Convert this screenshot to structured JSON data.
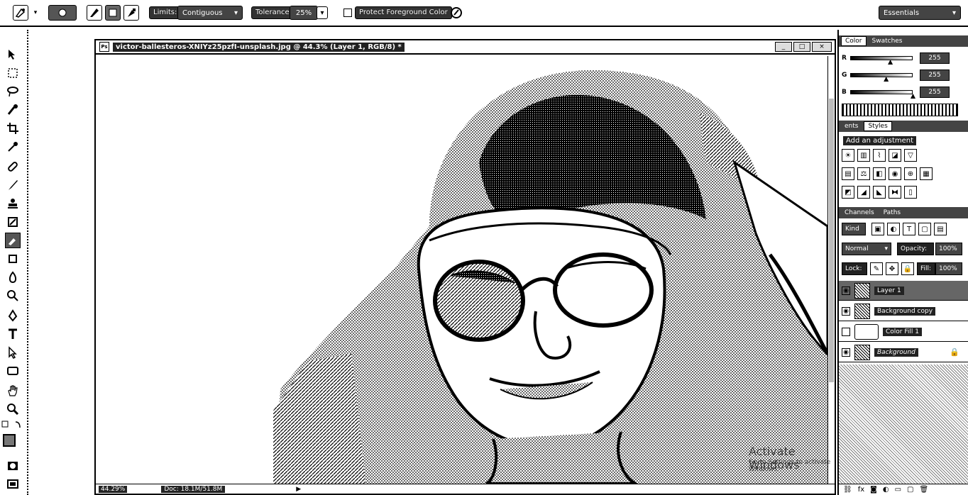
{
  "options_bar": {
    "limits_label": "Limits:",
    "limits_value": "Contiguous",
    "tolerance_label": "Tolerance:",
    "tolerance_value": "25%",
    "protect_fg_label": "Protect Foreground Color",
    "workspace_value": "Essentials",
    "icons": [
      "preset-picker-icon",
      "brush-size-icon",
      "sampling-continuous-icon",
      "sampling-once-icon",
      "sampling-swatch-icon",
      "pressure-icon"
    ]
  },
  "document": {
    "title": "victor-ballesteros-XNIYz25pzfI-unsplash.jpg @ 44.3% (Layer 1, RGB/8) *",
    "app_badge": "Ps",
    "zoom": "44.29%",
    "doc_info": "Doc: 18.1M/51.8M",
    "window_buttons": [
      "_",
      "□",
      "×"
    ]
  },
  "watermark": {
    "title": "Activate Windows",
    "subtitle": "Go to Settings to activate Windows."
  },
  "panels": {
    "color": {
      "tabs": [
        "Color",
        "Swatches"
      ],
      "sliders": [
        {
          "label": "R",
          "value": "255",
          "level": 0.62
        },
        {
          "label": "G",
          "value": "255",
          "level": 0.55
        },
        {
          "label": "B",
          "value": "255",
          "level": 1.0
        }
      ]
    },
    "adjustments": {
      "tabs": [
        "ents",
        "Styles"
      ],
      "add_label": "Add an adjustment"
    },
    "layers": {
      "tabs": [
        "Channels",
        "Paths"
      ],
      "kind_label": "Kind",
      "blend_mode": "Normal",
      "opacity_label": "Opacity:",
      "opacity_value": "100%",
      "fill_label": "Fill:",
      "fill_value": "100%",
      "lock_label": "Lock:",
      "items": [
        {
          "name": "Layer 1",
          "selected": true,
          "visible": true,
          "locked": false
        },
        {
          "name": "Background copy",
          "selected": false,
          "visible": true,
          "locked": false
        },
        {
          "name": "Color Fill 1",
          "selected": false,
          "visible": false,
          "locked": false
        },
        {
          "name": "Background",
          "selected": false,
          "visible": true,
          "locked": true
        }
      ]
    }
  }
}
